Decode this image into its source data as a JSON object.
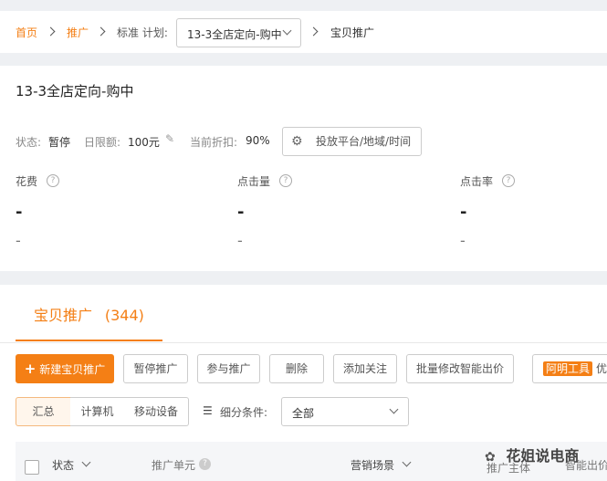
{
  "breadcrumb": {
    "home": "首页",
    "promote": "推广",
    "plan_prefix": "标准 计划:",
    "plan_value": "13-3全店定向-购中",
    "current": "宝贝推广"
  },
  "plan": {
    "title": "13-3全店定向-购中",
    "status_label": "状态:",
    "status_value": "暂停",
    "budget_label": "日限额:",
    "budget_value": "100元",
    "discount_label": "当前折扣:",
    "discount_value": "90%",
    "settings_button": "投放平台/地域/时间",
    "metrics": [
      {
        "label": "花费",
        "value": "-",
        "sub": "-"
      },
      {
        "label": "点击量",
        "value": "-",
        "sub": "-"
      },
      {
        "label": "点击率",
        "value": "-",
        "sub": "-"
      }
    ]
  },
  "list": {
    "tab_label": "宝贝推广",
    "tab_count": "(344)",
    "buttons": {
      "new": "新建宝贝推广",
      "pause": "暂停推广",
      "join": "参与推广",
      "delete": "删除",
      "follow": "添加关注",
      "bulk_bid": "批量修改智能出价",
      "tool_tag": "阿明工具",
      "tool_suffix": "优"
    },
    "devices": [
      "汇总",
      "计算机",
      "移动设备"
    ],
    "filter_label": "细分条件:",
    "filter_value": "全部",
    "columns": {
      "status": "状态",
      "unit": "推广单元",
      "scene": "营销场景",
      "subject": "推广主体",
      "smart_bid": "智能出价"
    }
  },
  "watermark": "花姐说电商",
  "colors": {
    "accent": "#f47f15",
    "background": "#eef0f3"
  }
}
